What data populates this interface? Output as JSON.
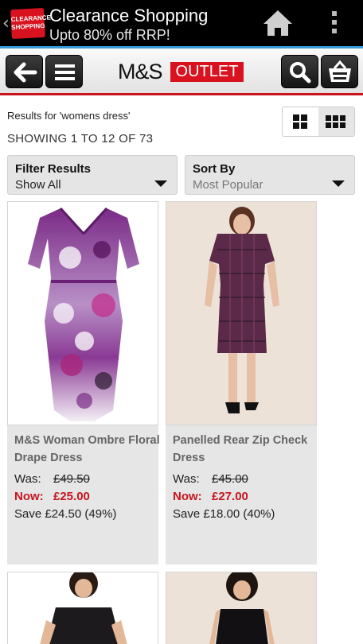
{
  "appbar": {
    "app_icon_text": "CLEARANCE SHOPPING",
    "title": "Clearance Shopping",
    "subtitle": "Upto 80% off RRP!"
  },
  "header": {
    "logo_left": "M&S",
    "logo_right": "OUTLET"
  },
  "results": {
    "query_label": "Results for 'womens dress'",
    "showing": "SHOWING 1 TO 12 OF 73"
  },
  "filter": {
    "label": "Filter Results",
    "value": "Show All"
  },
  "sort": {
    "label": "Sort By",
    "value": "Most Popular"
  },
  "products": [
    {
      "name": "M&S Woman Ombre Floral Drape Dress",
      "was_label": "Was:",
      "was": "£49.50",
      "now_label": "Now:",
      "now": "£25.00",
      "save": "Save £24.50 (49%)"
    },
    {
      "name": "Panelled Rear Zip Check Dress",
      "was_label": "Was:",
      "was": "£45.00",
      "now_label": "Now:",
      "now": "£27.00",
      "save": "Save £18.00 (40%)"
    }
  ],
  "colors": {
    "brand_red": "#d9121f",
    "price_red": "#c8141c",
    "accent_blue": "#3a9ad9"
  }
}
